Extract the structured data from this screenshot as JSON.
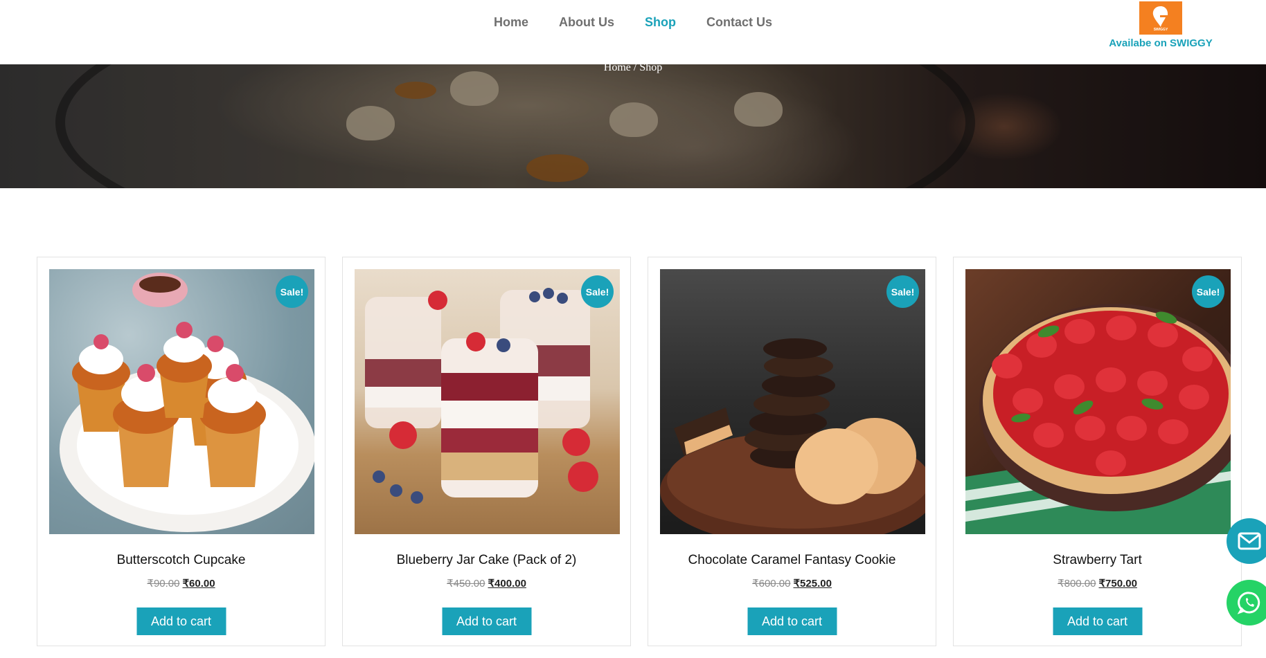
{
  "nav": {
    "items": [
      {
        "label": "Home",
        "active": false
      },
      {
        "label": "About Us",
        "active": false
      },
      {
        "label": "Shop",
        "active": true
      },
      {
        "label": "Contact Us",
        "active": false
      }
    ]
  },
  "swiggy": {
    "logo_text": "SWIGGY",
    "caption": "Availabe on SWIGGY",
    "brand_color": "#f48020"
  },
  "breadcrumb": "Home / Shop",
  "accent_color": "#1aa2b9",
  "products": [
    {
      "name": "Butterscotch Cupcake",
      "old_price": "₹90.00",
      "new_price": "₹60.00",
      "badge": "Sale!",
      "button": "Add to cart"
    },
    {
      "name": "Blueberry Jar Cake (Pack of 2)",
      "old_price": "₹450.00",
      "new_price": "₹400.00",
      "badge": "Sale!",
      "button": "Add to cart"
    },
    {
      "name": "Chocolate Caramel Fantasy Cookie",
      "old_price": "₹600.00",
      "new_price": "₹525.00",
      "badge": "Sale!",
      "button": "Add to cart"
    },
    {
      "name": "Strawberry Tart",
      "old_price": "₹800.00",
      "new_price": "₹750.00",
      "badge": "Sale!",
      "button": "Add to cart"
    }
  ],
  "floating": {
    "mail_icon": "envelope-icon",
    "whatsapp_icon": "whatsapp-icon"
  }
}
